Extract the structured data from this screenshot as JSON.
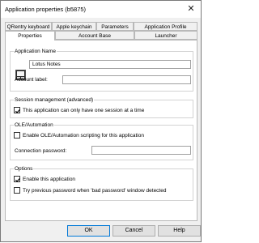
{
  "window": {
    "title": "Application properties (b5875)"
  },
  "tabs": {
    "row1": [
      "QRentry keyboard",
      "Apple keychain",
      "Parameters",
      "Application Profile"
    ],
    "row2": [
      "Properties",
      "Account Base",
      "Launcher"
    ],
    "selected": "Properties"
  },
  "application_name": {
    "legend": "Application Name",
    "name_value": "Lotus Notes",
    "account_label": "Account label:",
    "account_value": ""
  },
  "session": {
    "legend": "Session management (advanced)",
    "single_session_label": "This application can only have one session at a time",
    "single_session_checked": true
  },
  "ole": {
    "legend": "OLE/Automation",
    "enable_label": "Enable OLE/Automation scripting for this application",
    "enable_checked": false,
    "password_label": "Connection password:",
    "password_value": ""
  },
  "options": {
    "legend": "Options",
    "enable_app_label": "Enable this application",
    "enable_app_checked": true,
    "try_prev_label": "Try previous password when 'bad password' window detected",
    "try_prev_checked": false
  },
  "buttons": {
    "ok": "OK",
    "cancel": "Cancel",
    "help": "Help"
  },
  "icons": {
    "close": "close-icon",
    "app": "lotus-notes-app-icon",
    "check": "checkmark-icon"
  }
}
